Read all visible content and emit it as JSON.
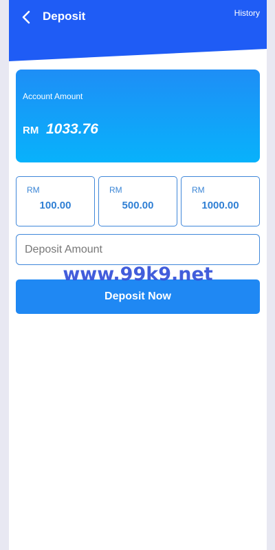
{
  "header": {
    "title": "Deposit",
    "history_label": "History",
    "color": "#1f5cf5"
  },
  "account": {
    "label": "Account Amount",
    "currency": "RM",
    "value": "1033.76"
  },
  "amount_options": [
    {
      "currency": "RM",
      "value": "100.00"
    },
    {
      "currency": "RM",
      "value": "500.00"
    },
    {
      "currency": "RM",
      "value": "1000.00"
    }
  ],
  "deposit_input": {
    "placeholder": "Deposit Amount",
    "value": ""
  },
  "deposit_button": {
    "label": "Deposit Now"
  },
  "watermark": {
    "text": "www.99k9.net"
  },
  "icons": {
    "back": "chevron-left-icon"
  }
}
